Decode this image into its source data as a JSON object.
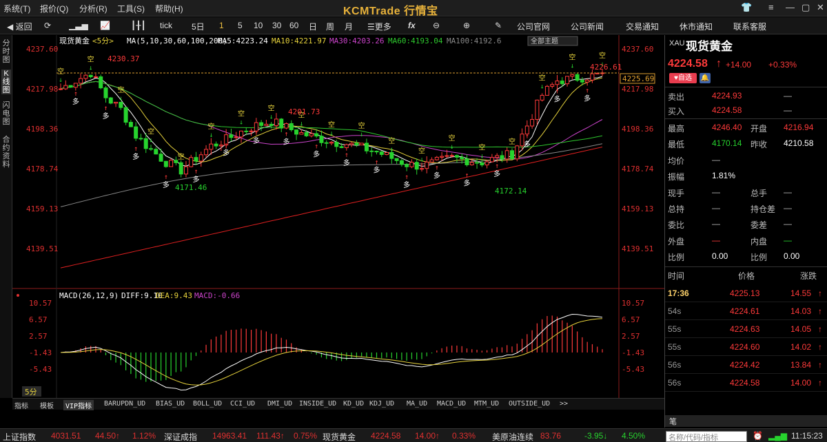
{
  "app": {
    "brand": "KCMTrade 行情宝"
  },
  "menu": [
    "系统(T)",
    "报价(Q)",
    "分析(R)",
    "工具(S)",
    "帮助(H)"
  ],
  "toolbar": {
    "back": "返回",
    "tick": "tick",
    "periods": [
      "5日",
      "1",
      "5",
      "10",
      "30",
      "60",
      "日",
      "周",
      "月"
    ],
    "active_period": "1",
    "more": "更多",
    "links": [
      "公司官网",
      "公司新闻",
      "交易通知",
      "休市通知",
      "联系客服"
    ]
  },
  "leftbar": [
    "分时图",
    "K线图",
    "闪电图",
    "合约资料"
  ],
  "chart": {
    "header": {
      "symbol": "现货黄金",
      "period": "<5分>",
      "ma": "MA(5,10,30,60,100,200)",
      "ma5": "MA5:4223.24",
      "ma10": "MA10:4221.97",
      "ma30": "MA30:4203.26",
      "ma60": "MA60:4193.04",
      "ma100": "MA100:4192.6",
      "topic": "全部主题"
    },
    "price_ticks": [
      "4237.60",
      "4217.98",
      "4198.36",
      "4178.74",
      "4159.13",
      "4139.51"
    ],
    "annotations": {
      "high": "4230.37",
      "low": "4171.46",
      "mid": "4201.73",
      "low2": "4172.14",
      "last": "4226.61",
      "cur_box": "4225.69"
    },
    "signal_up": "多",
    "signal_down": "空",
    "macd_header": {
      "name": "MACD(26,12,9)",
      "diff": "DIFF:9.10",
      "dea": "DEA:9.43",
      "macd": "MACD:-0.66"
    },
    "macd_ticks": [
      "10.57",
      "6.57",
      "2.57",
      "-1.43",
      "-5.43"
    ],
    "period_badge": "5分",
    "colors": {
      "up": "#ff3a3a",
      "down": "#27d32e",
      "ma5": "#ffffff",
      "ma10": "#e6d23c",
      "ma30": "#cc44cc",
      "ma60": "#2ec82e",
      "ma100": "#888888",
      "ma200": "#e02020"
    }
  },
  "indicator_tabs": [
    "指标",
    "模板",
    "VIP指标",
    "BARUPDN_UD",
    "BIAS_UD",
    "BOLL_UD",
    "CCI_UD",
    "DMI_UD",
    "INSIDE_UD",
    "KD_UD",
    "KDJ_UD",
    "MA_UD",
    "MACD_UD",
    "MTM_UD",
    "OUTSIDE_UD",
    ">>"
  ],
  "right": {
    "code": "XAU",
    "name": "现货黄金",
    "price": "4224.58",
    "change": "+14.00",
    "pct": "+0.33%",
    "fav": "自选",
    "sell_label": "卖出",
    "sell": "4224.93",
    "buy_label": "买入",
    "buy": "4224.58",
    "stats": [
      {
        "l1": "最高",
        "v1": "4246.40",
        "l2": "开盘",
        "v2": "4216.94",
        "c1": "red",
        "c2": "red"
      },
      {
        "l1": "最低",
        "v1": "4170.14",
        "l2": "昨收",
        "v2": "4210.58",
        "c1": "green",
        "c2": "white"
      },
      {
        "l1": "均价",
        "v1": "—",
        "l2": "",
        "v2": "",
        "c1": "grey",
        "c2": "grey"
      },
      {
        "l1": "振幅",
        "v1": "1.81%",
        "l2": "",
        "v2": "",
        "c1": "white",
        "c2": "grey"
      },
      {
        "l1": "现手",
        "v1": "—",
        "l2": "总手",
        "v2": "—",
        "c1": "grey",
        "c2": "grey"
      },
      {
        "l1": "总持",
        "v1": "—",
        "l2": "持仓差",
        "v2": "—",
        "c1": "grey",
        "c2": "grey"
      },
      {
        "l1": "委比",
        "v1": "—",
        "l2": "委差",
        "v2": "—",
        "c1": "grey",
        "c2": "grey"
      },
      {
        "l1": "外盘",
        "v1": "—",
        "l2": "内盘",
        "v2": "—",
        "c1": "red",
        "c2": "green"
      },
      {
        "l1": "比例",
        "v1": "0.00",
        "l2": "比例",
        "v2": "0.00",
        "c1": "white",
        "c2": "white"
      }
    ],
    "ticks_header": [
      "时间",
      "价格",
      "涨跌"
    ],
    "ticks": [
      {
        "t": "17:36",
        "p": "4225.13",
        "c": "14.55"
      },
      {
        "t": "54s",
        "p": "4224.61",
        "c": "14.03"
      },
      {
        "t": "55s",
        "p": "4224.63",
        "c": "14.05"
      },
      {
        "t": "55s",
        "p": "4224.60",
        "c": "14.02"
      },
      {
        "t": "56s",
        "p": "4224.42",
        "c": "13.84"
      },
      {
        "t": "56s",
        "p": "4224.58",
        "c": "14.00"
      }
    ],
    "footer_label": "笔"
  },
  "status": {
    "items": [
      {
        "name": "上证指数",
        "v": "4031.51",
        "c": "44.50↑",
        "p": "1.12%"
      },
      {
        "name": "深证成指",
        "v": "14963.41",
        "c": "111.43↑",
        "p": "0.75%"
      },
      {
        "name": "现货黄金",
        "v": "4224.58",
        "c": "14.00↑",
        "p": "0.33%"
      },
      {
        "name": "美原油连续",
        "v": "83.76",
        "c": "-3.95↓",
        "p": "4.50%"
      }
    ],
    "search_placeholder": "名称/代码/指标",
    "time": "11:15:23"
  }
}
